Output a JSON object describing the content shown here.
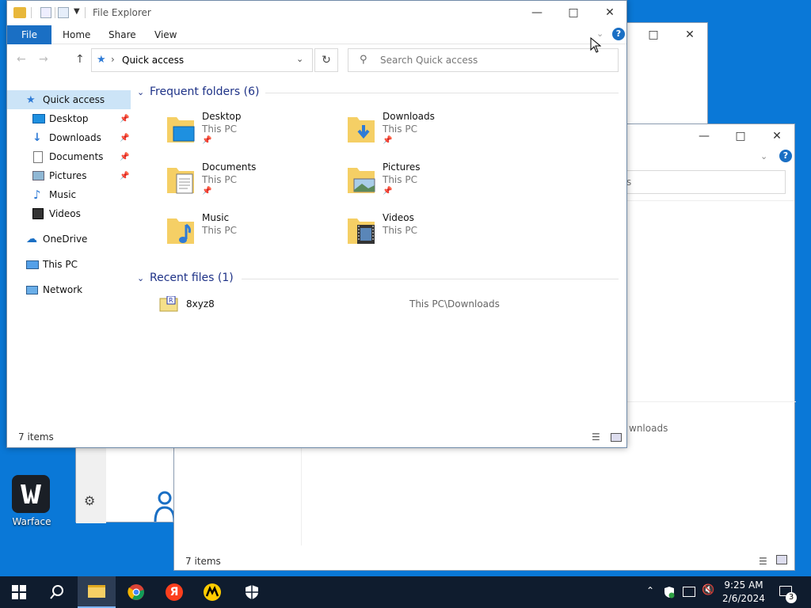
{
  "main_window": {
    "title": "File Explorer",
    "ribbon_tabs": [
      "File",
      "Home",
      "Share",
      "View"
    ],
    "address": "Quick access",
    "search_placeholder": "Search Quick access",
    "sidebar": [
      {
        "label": "Quick access",
        "icon": "star-icon",
        "pinned": false
      },
      {
        "label": "Desktop",
        "icon": "desktop-icon",
        "pinned": true
      },
      {
        "label": "Downloads",
        "icon": "download-arrow-icon",
        "pinned": true
      },
      {
        "label": "Documents",
        "icon": "documents-icon",
        "pinned": true
      },
      {
        "label": "Pictures",
        "icon": "pictures-icon",
        "pinned": true
      },
      {
        "label": "Music",
        "icon": "music-note-icon",
        "pinned": false
      },
      {
        "label": "Videos",
        "icon": "videos-icon",
        "pinned": false
      },
      {
        "label": "OneDrive",
        "icon": "cloud-icon",
        "pinned": false
      },
      {
        "label": "This PC",
        "icon": "computer-icon",
        "pinned": false
      },
      {
        "label": "Network",
        "icon": "network-icon",
        "pinned": false
      }
    ],
    "frequent_header": "Frequent folders (6)",
    "frequent_folders": [
      {
        "name": "Desktop",
        "location": "This PC",
        "pinned": true
      },
      {
        "name": "Downloads",
        "location": "This PC",
        "pinned": true
      },
      {
        "name": "Documents",
        "location": "This PC",
        "pinned": true
      },
      {
        "name": "Pictures",
        "location": "This PC",
        "pinned": true
      },
      {
        "name": "Music",
        "location": "This PC",
        "pinned": false
      },
      {
        "name": "Videos",
        "location": "This PC",
        "pinned": false
      }
    ],
    "recent_header": "Recent files (1)",
    "recent_files": [
      {
        "name": "8xyz8",
        "path": "This PC\\Downloads"
      }
    ],
    "status_text": "7 items"
  },
  "back_window": {
    "status_text": "7 items",
    "search_fragment": "s",
    "path_fragment": "wnloads"
  },
  "desktop": {
    "shortcut_label": "Warface"
  },
  "taskbar": {
    "time": "9:25 AM",
    "date": "2/6/2024",
    "notification_count": "3"
  },
  "colors": {
    "accent": "#1a6fc4",
    "desktop": "#0a78d7",
    "taskbar": "#0f1c2e",
    "group_header": "#1e3287"
  }
}
